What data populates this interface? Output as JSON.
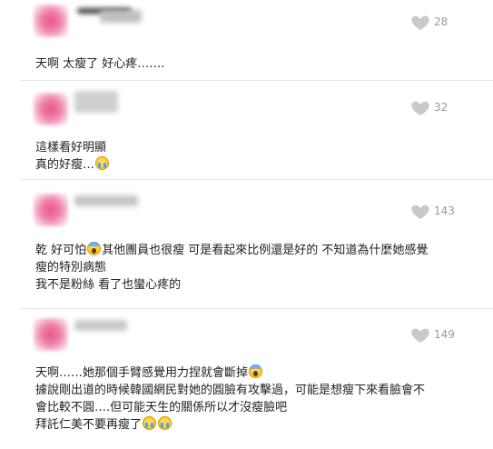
{
  "comments": [
    {
      "likes": "28",
      "lines": [
        "天啊 太瘦了 好心疼……."
      ],
      "emoji": []
    },
    {
      "likes": "32",
      "lines": [
        "這樣看好明顯",
        "真的好瘦…"
      ],
      "emoji": [
        "crying-face"
      ]
    },
    {
      "likes": "143",
      "lines": [
        "乾 好可怕",
        "其他團員也很瘦 可是看起來比例還是好的 不知道為什麼她感覺",
        "瘦的特別病態",
        "我不是粉絲 看了也蠻心疼的"
      ],
      "emoji": [
        "screaming-face"
      ]
    },
    {
      "likes": "149",
      "lines": [
        "天啊……她那個手臂感覺用力捏就會斷掉",
        "據說剛出道的時候韓國網民對她的圓臉有攻擊過，可能是想瘦下來看臉會不",
        "會比較不圓….但可能天生的關係所以才沒瘦臉吧",
        "拜託仁美不要再瘦了"
      ],
      "emoji": [
        "screaming-face",
        "crying-face",
        "crying-face"
      ]
    }
  ]
}
